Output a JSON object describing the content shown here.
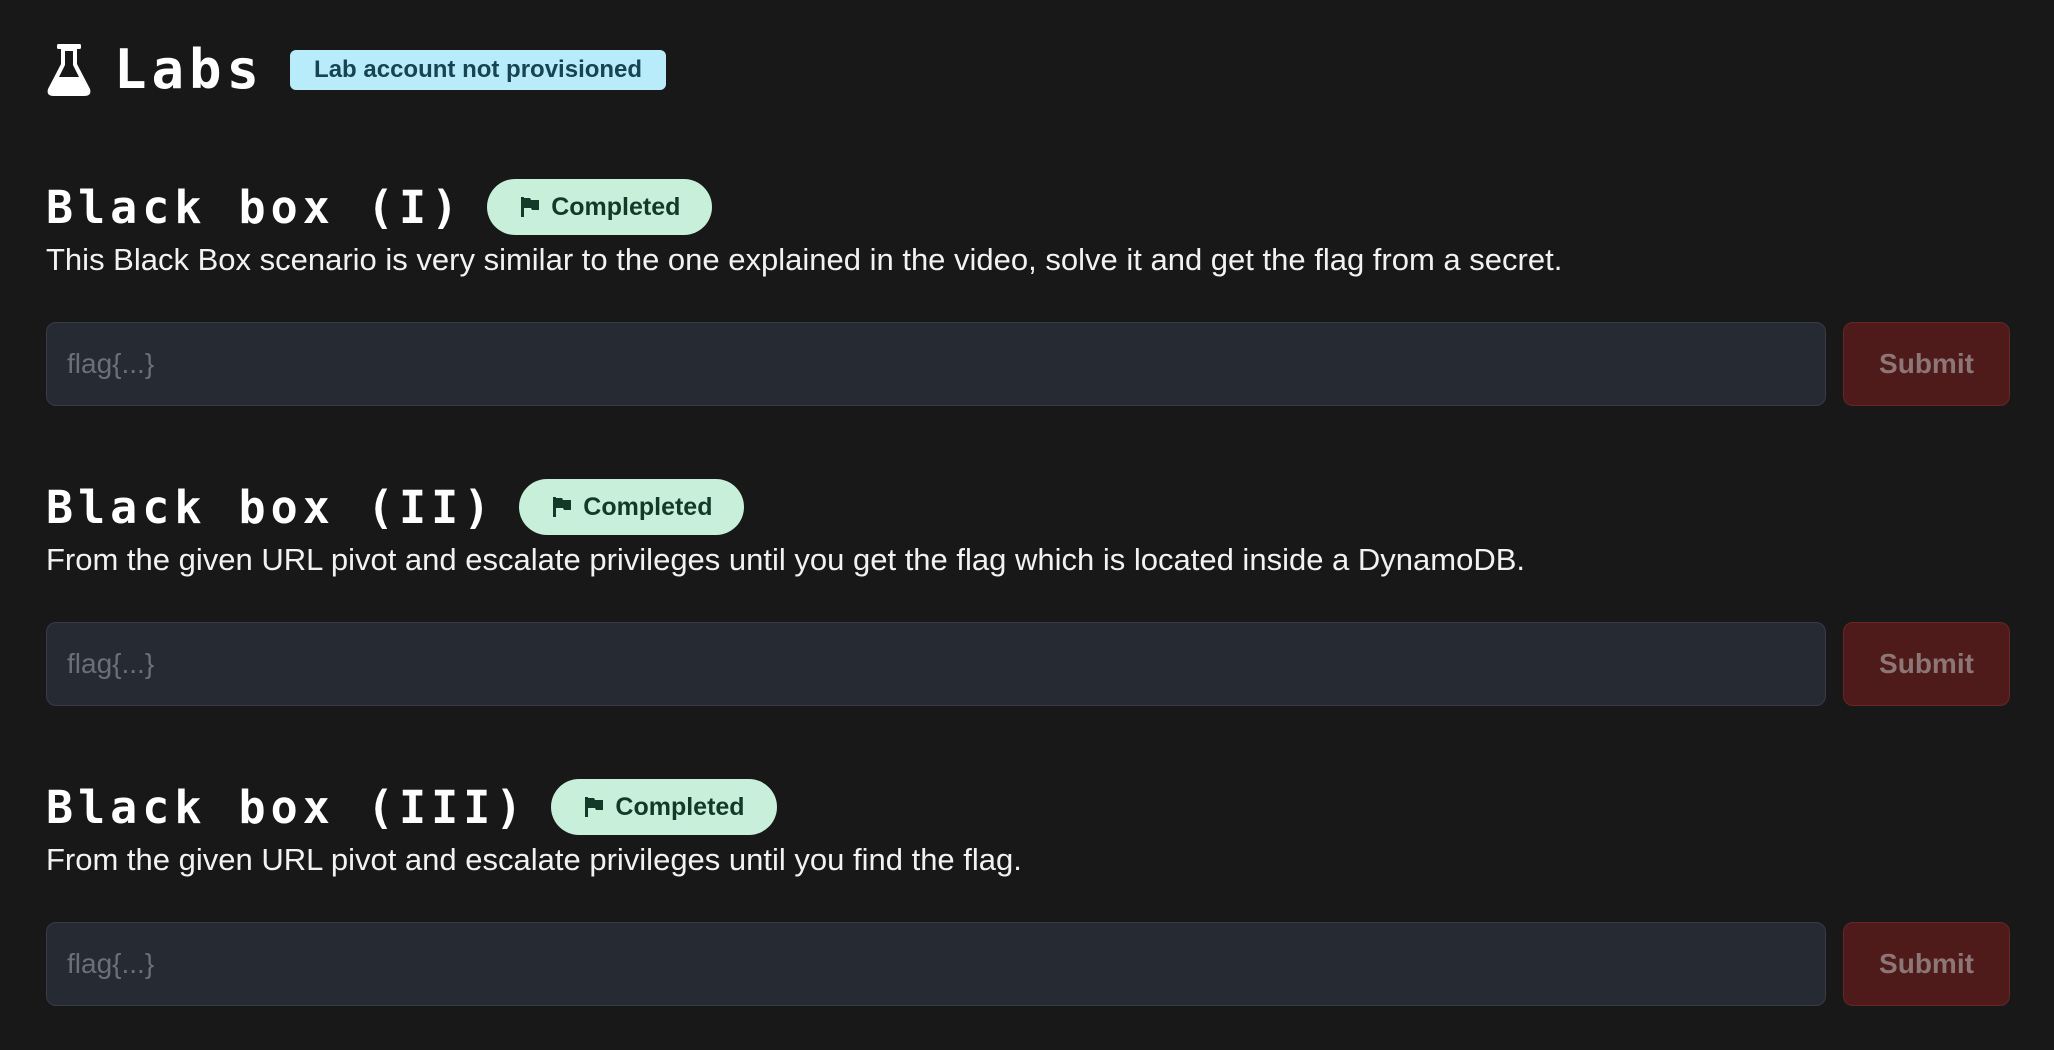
{
  "header": {
    "icon": "flask-icon",
    "title": "Labs",
    "badge": "Lab account not provisioned"
  },
  "colors": {
    "background": "#181818",
    "info_badge": "#b8ecfa",
    "completed_badge": "#c7efd9",
    "submit_button": "#4e1a1a",
    "input_background": "#262a33"
  },
  "labs": [
    {
      "title": "Black box (I)",
      "status": "Completed",
      "status_icon": "flag-icon",
      "description": "This Black Box scenario is very similar to the one explained in the video, solve it and get the flag from a secret.",
      "input_placeholder": "flag{...}",
      "submit_label": "Submit"
    },
    {
      "title": "Black box (II)",
      "status": "Completed",
      "status_icon": "flag-icon",
      "description": "From the given URL pivot and escalate privileges until you get the flag which is located inside a DynamoDB.",
      "input_placeholder": "flag{...}",
      "submit_label": "Submit"
    },
    {
      "title": "Black box (III)",
      "status": "Completed",
      "status_icon": "flag-icon",
      "description": "From the given URL pivot and escalate privileges until you find the flag.",
      "input_placeholder": "flag{...}",
      "submit_label": "Submit"
    }
  ]
}
